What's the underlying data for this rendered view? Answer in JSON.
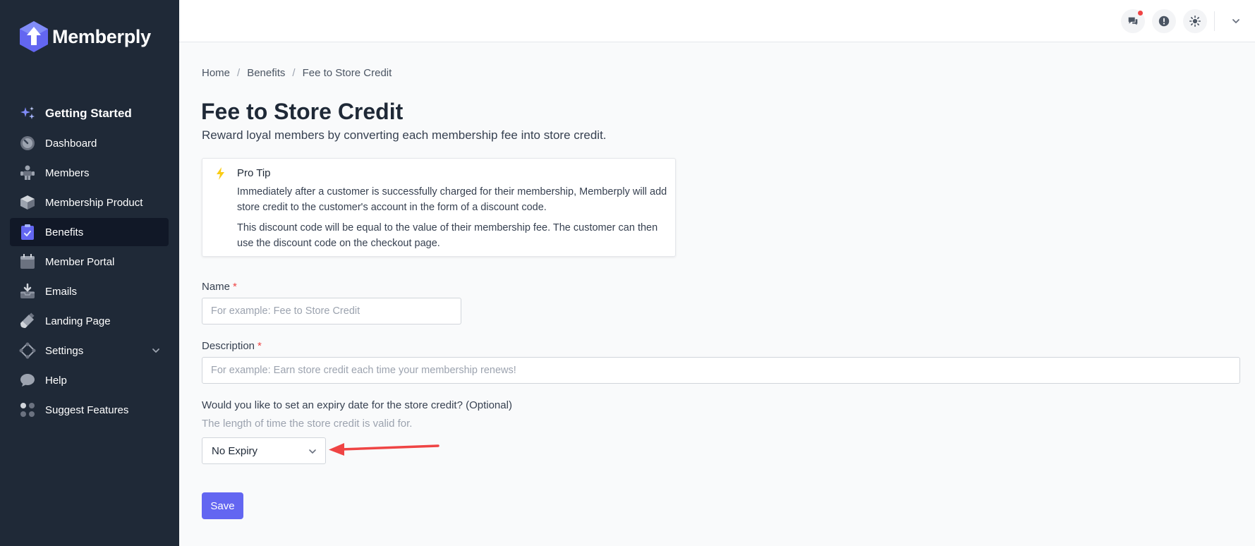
{
  "brand": {
    "name": "Memberply"
  },
  "sidebar": {
    "items": [
      {
        "label": "Getting Started",
        "icon": "sparkles-icon"
      },
      {
        "label": "Dashboard",
        "icon": "gauge-icon"
      },
      {
        "label": "Members",
        "icon": "members-icon"
      },
      {
        "label": "Membership Product",
        "icon": "box-icon"
      },
      {
        "label": "Benefits",
        "icon": "clipboard-check-icon",
        "active": true
      },
      {
        "label": "Member Portal",
        "icon": "calendar-icon"
      },
      {
        "label": "Emails",
        "icon": "inbox-icon"
      },
      {
        "label": "Landing Page",
        "icon": "brush-icon"
      },
      {
        "label": "Settings",
        "icon": "settings-icon"
      },
      {
        "label": "Help",
        "icon": "chat-bubble-icon"
      },
      {
        "label": "Suggest Features",
        "icon": "dots-grid-icon"
      }
    ]
  },
  "header": {
    "icons": [
      "chat-icon",
      "alert-icon",
      "sun-icon",
      "chevron-down-icon"
    ],
    "notification_color": "#ef4444"
  },
  "breadcrumb": {
    "home": "Home",
    "benefits": "Benefits",
    "current": "Fee to Store Credit",
    "separator": "/"
  },
  "page": {
    "title": "Fee to Store Credit",
    "subtitle": "Reward loyal members by converting each membership fee into store credit."
  },
  "protip": {
    "title": "Pro Tip",
    "p1": "Immediately after a customer is successfully charged for their membership, Memberply will add store credit to the customer's account in the form of a discount code.",
    "p2": "This discount code will be equal to the value of their membership fee. The customer can then use the discount code on the checkout page."
  },
  "form": {
    "name_label": "Name",
    "name_placeholder": "For example: Fee to Store Credit",
    "description_label": "Description",
    "description_placeholder": "For example: Earn store credit each time your membership renews!",
    "required_mark": "*",
    "expiry_label": "Would you like to set an expiry date for the store credit? (Optional)",
    "expiry_help": "The length of time the store credit is valid for.",
    "expiry_value": "No Expiry",
    "save_label": "Save"
  },
  "colors": {
    "sidebar_bg": "#1f2937",
    "accent": "#6366f1",
    "annotation_arrow": "#ef4444"
  }
}
